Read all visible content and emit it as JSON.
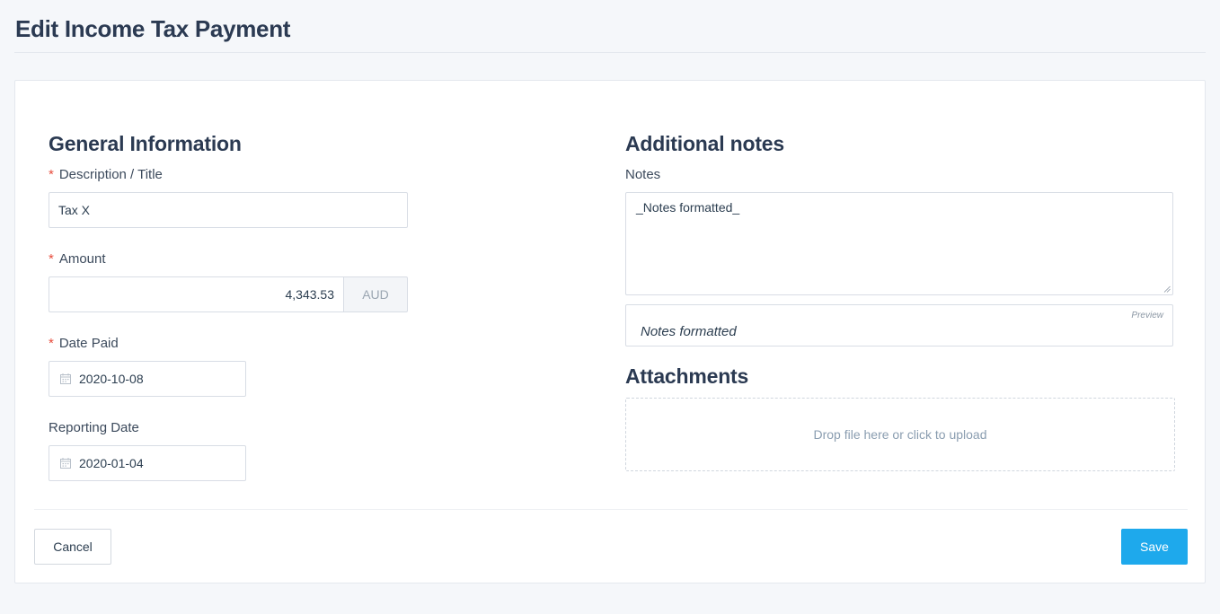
{
  "page": {
    "title": "Edit Income Tax Payment"
  },
  "general": {
    "heading": "General Information",
    "description": {
      "label": "Description / Title",
      "required_mark": "*",
      "value": "Tax X"
    },
    "amount": {
      "label": "Amount",
      "required_mark": "*",
      "value": "4,343.53",
      "currency": "AUD"
    },
    "date_paid": {
      "label": "Date Paid",
      "required_mark": "*",
      "value": "2020-10-08"
    },
    "reporting_date": {
      "label": "Reporting Date",
      "value": "2020-01-04"
    }
  },
  "notes": {
    "heading": "Additional notes",
    "label": "Notes",
    "value": "_Notes formatted_",
    "preview_tag": "Preview",
    "preview_text": "Notes formatted"
  },
  "attachments": {
    "heading": "Attachments",
    "dropzone_text": "Drop file here or click to upload"
  },
  "actions": {
    "cancel_label": "Cancel",
    "save_label": "Save"
  },
  "colors": {
    "primary": "#1ea9ec",
    "required": "#e74c3c",
    "heading": "#2b3a52"
  },
  "icons": {
    "date_field": "calendar-icon"
  }
}
